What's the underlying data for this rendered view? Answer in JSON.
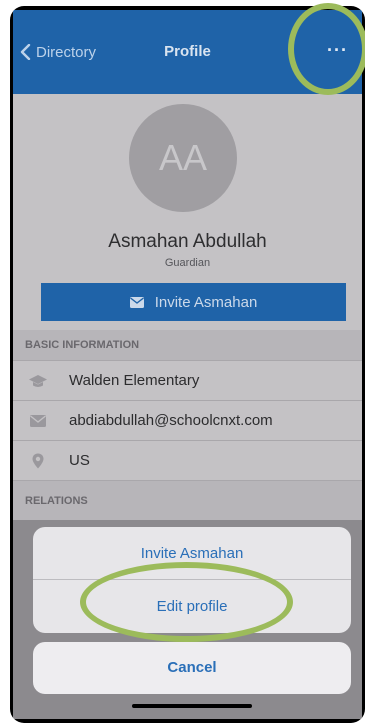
{
  "navbar": {
    "back_label": "Directory",
    "title": "Profile",
    "more_label": "···"
  },
  "profile": {
    "initials": "AA",
    "name": "Asmahan Abdullah",
    "role": "Guardian",
    "invite_button_label": "Invite Asmahan"
  },
  "basic_information": {
    "header": "BASIC INFORMATION",
    "items": [
      {
        "icon": "graduation-cap-icon",
        "text": "Walden Elementary"
      },
      {
        "icon": "envelope-icon",
        "text": "abdiabdullah@schoolcnxt.com"
      },
      {
        "icon": "location-pin-icon",
        "text": "US"
      }
    ]
  },
  "relations": {
    "header": "RELATIONS"
  },
  "action_sheet": {
    "items": [
      "Invite Asmahan",
      "Edit profile"
    ],
    "cancel_label": "Cancel"
  },
  "colors": {
    "brand_blue": "#1f63a8",
    "action_text": "#2a6fb8",
    "highlight_ring": "#9cbb5b"
  }
}
